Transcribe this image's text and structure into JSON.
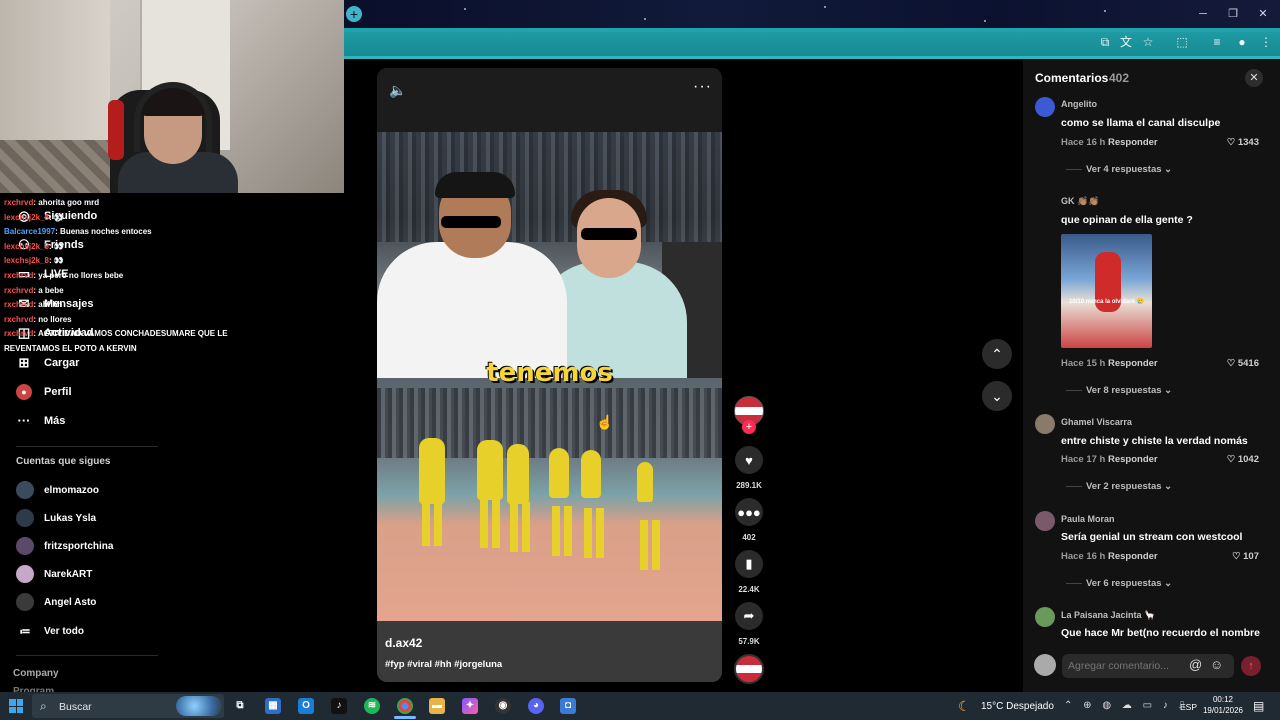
{
  "chat": [
    {
      "user": "rxchrvd",
      "text": ": ahorita goo mrd",
      "color": "red"
    },
    {
      "user": "lexchsj2k_8",
      "text": ": 👀",
      "color": "red"
    },
    {
      "user": "Balcarce1997",
      "text": ": Buenas noches entoces",
      "color": "blue"
    },
    {
      "user": "lexchsj2k_8",
      "text": ": 👀",
      "color": "red"
    },
    {
      "user": "lexchsj2k_8",
      "text": ": 👀",
      "color": "red"
    },
    {
      "user": "rxchrvd",
      "text": ": ya pero no llores bebe",
      "color": "red"
    },
    {
      "user": "rxchrvd",
      "text": ": a bebe",
      "color": "red"
    },
    {
      "user": "rxchrvd",
      "text": ": ahhhh",
      "color": "red"
    },
    {
      "user": "rxchrvd",
      "text": ": no llores",
      "color": "red"
    },
    {
      "user": "rxchrvd",
      "text": ": ACTIVIDAD VAMOS CONCHADESUMARE QUE LE",
      "color": "red"
    },
    {
      "user": "",
      "text": "REVENTAMOS EL POTO A KERVIN",
      "color": "red"
    }
  ],
  "sidebar": {
    "nav": [
      {
        "label": "Siguiendo",
        "icon": "following-icon"
      },
      {
        "label": "Friends",
        "icon": "friends-icon"
      },
      {
        "label": "LIVE",
        "icon": "live-icon"
      },
      {
        "label": "Mensajes",
        "icon": "messages-icon"
      },
      {
        "label": "Actividad",
        "icon": "activity-icon"
      },
      {
        "label": "Cargar",
        "icon": "upload-icon"
      },
      {
        "label": "Perfil",
        "icon": "profile-icon"
      },
      {
        "label": "Más",
        "icon": "more-icon"
      }
    ],
    "following_title": "Cuentas que sigues",
    "accounts": [
      "elmomazoo",
      "Lukas Ysla",
      "fritzsportchina",
      "NarekART",
      "Angel Asto"
    ],
    "see_all": "Ver todo",
    "company": "Company",
    "program": "Program"
  },
  "video": {
    "caption": "tenemos",
    "author": "d.ax42",
    "tags": "#fyp #viral #hh #jorgeluna"
  },
  "actions": {
    "likes": "289.1K",
    "comments": "402",
    "saves": "22.4K",
    "shares": "57.9K"
  },
  "comments_panel": {
    "title": "Comentarios",
    "count": "402",
    "reply_label": "Responder",
    "input_placeholder": "Agregar comentario...",
    "items": [
      {
        "user": "Angelito",
        "text": "como se llama el canal disculpe",
        "time": "Hace 16 h",
        "likes": "1343",
        "more": "Ver 4 respuestas"
      },
      {
        "user": "GK 👏🏽👏🏽",
        "text": "que opinan de ella gente ?",
        "time": "Hace 15 h",
        "likes": "5416",
        "more": "Ver 8 respuestas",
        "image_text": "10/10 nunca la olvidaré 🥲"
      },
      {
        "user": "Ghamel Viscarra",
        "text": "entre chiste y chiste la verdad nomás",
        "time": "Hace 17 h",
        "likes": "1042",
        "more": "Ver 2 respuestas"
      },
      {
        "user": "Paula Moran",
        "text": "Sería genial un stream con westcool",
        "time": "Hace 16 h",
        "likes": "107",
        "more": "Ver 6 respuestas"
      },
      {
        "user": "La Paisana Jacinta 🦙",
        "text": "Que hace Mr bet(no recuerdo el nombre",
        "time": "",
        "likes": "",
        "more": ""
      }
    ]
  },
  "taskbar": {
    "search": "Buscar",
    "weather": "15°C  Despejado",
    "lang": "ESP",
    "time": "00:12",
    "date": "19/01/2026"
  },
  "colors": {
    "accent": "#fe2c55",
    "teal": "#1fa3ad",
    "panel": "#121212"
  }
}
